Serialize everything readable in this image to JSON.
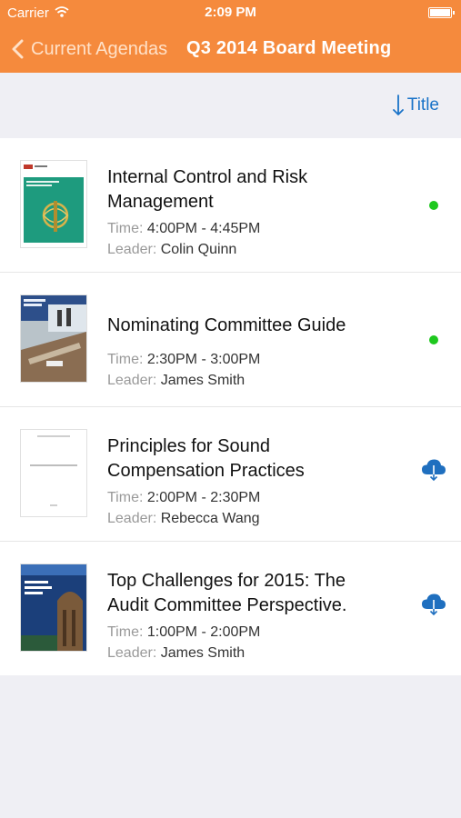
{
  "status_bar": {
    "carrier": "Carrier",
    "time": "2:09 PM"
  },
  "nav": {
    "back_label": "Current Agendas",
    "title": "Q3 2014 Board Meeting"
  },
  "toolbar": {
    "sort_label": "Title"
  },
  "items": [
    {
      "title": "Internal Control and Risk Management",
      "time_label": "Time:",
      "time": "4:00PM - 4:45PM",
      "leader_label": "Leader:",
      "leader": "Colin Quinn",
      "status": "downloaded",
      "thumb_text": "Internal Control and Risk Management"
    },
    {
      "title": "Nominating Committee Guide",
      "time_label": "Time:",
      "time": "2:30PM - 3:00PM",
      "leader_label": "Leader:",
      "leader": "James Smith",
      "status": "downloaded",
      "thumb_text": "Nominating Committee Guide 2013"
    },
    {
      "title": "Principles for Sound Compensation Practices",
      "time_label": "Time:",
      "time": "2:00PM - 2:30PM",
      "leader_label": "Leader:",
      "leader": "Rebecca Wang",
      "status": "cloud",
      "thumb_text": "FSF Principles for Sound Compensation Practices"
    },
    {
      "title": "Top Challenges for 2015: The Audit Committee Perspective.",
      "time_label": "Time:",
      "time": "1:00PM - 2:00PM",
      "leader_label": "Leader:",
      "leader": "James Smith",
      "status": "cloud",
      "thumb_text": "Global Boardroom Insights"
    }
  ],
  "colors": {
    "nav": "#f58a3d",
    "accent": "#1a73c8",
    "downloaded_dot": "#1ec81e",
    "background": "#efeff4"
  }
}
